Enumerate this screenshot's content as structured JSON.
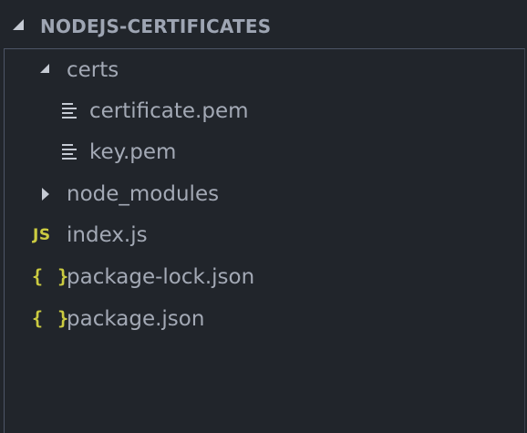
{
  "explorer": {
    "section_title": "NODEJS-CERTIFICATES",
    "section_expanded": true,
    "items": [
      {
        "label": "certs",
        "kind": "folder",
        "expanded": true,
        "depth": 1,
        "icon": "chevron-down-icon"
      },
      {
        "label": "certificate.pem",
        "kind": "file",
        "depth": 2,
        "icon": "text-file-icon"
      },
      {
        "label": "key.pem",
        "kind": "file",
        "depth": 2,
        "icon": "text-file-icon"
      },
      {
        "label": "node_modules",
        "kind": "folder",
        "expanded": false,
        "depth": 1,
        "icon": "chevron-right-icon"
      },
      {
        "label": "index.js",
        "kind": "file",
        "depth": 1,
        "icon": "js-file-icon",
        "icon_text": "JS"
      },
      {
        "label": "package-lock.json",
        "kind": "file",
        "depth": 1,
        "icon": "json-file-icon",
        "icon_text": "{ }"
      },
      {
        "label": "package.json",
        "kind": "file",
        "depth": 1,
        "icon": "json-file-icon",
        "icon_text": "{ }"
      }
    ]
  },
  "colors": {
    "background": "#21252b",
    "header_text": "#9ea5b3",
    "item_text": "#a3a9b5",
    "icon_gray": "#c5cad3",
    "icon_yellow": "#cbcb41",
    "border": "#4d5566"
  }
}
